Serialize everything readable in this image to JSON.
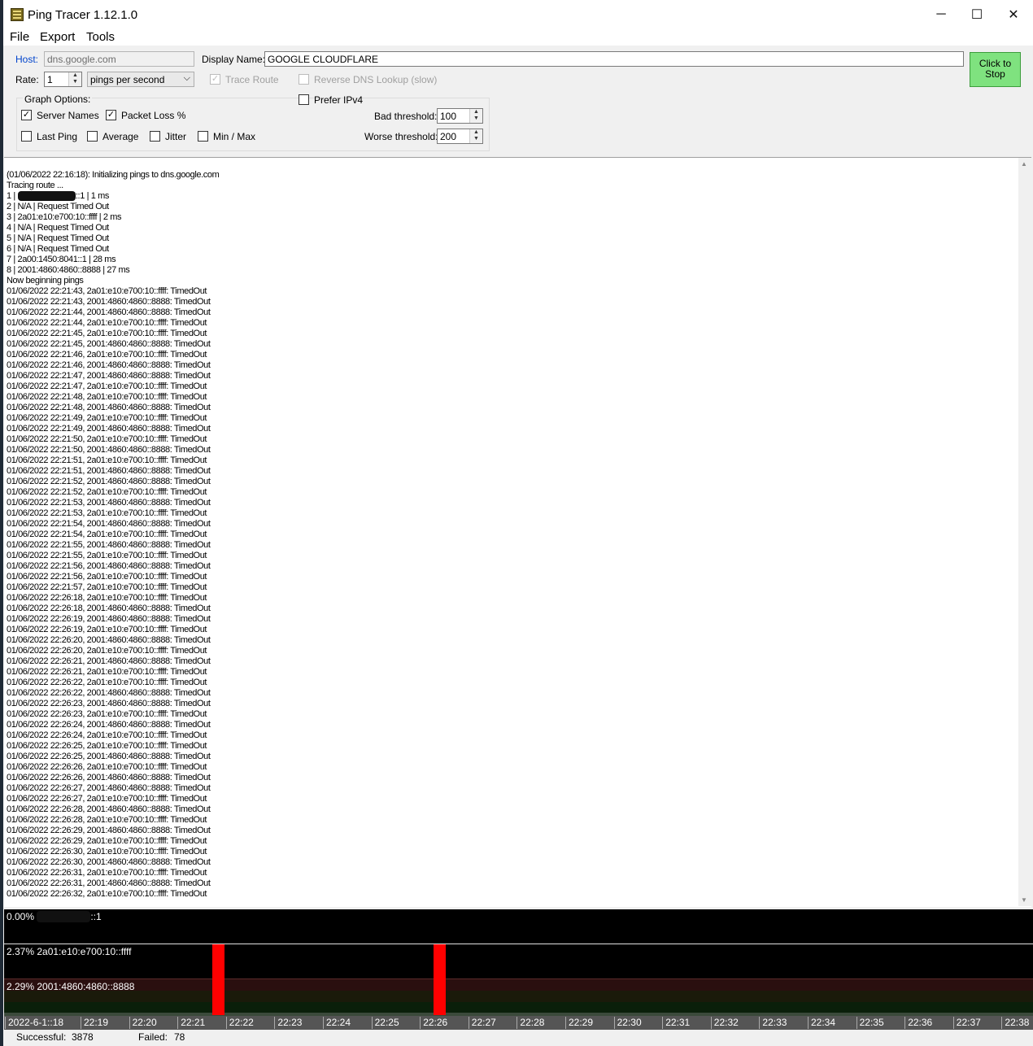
{
  "window": {
    "title": "Ping Tracer 1.12.1.0",
    "controls": [
      "─",
      "☐",
      "✕"
    ]
  },
  "menu": [
    "File",
    "Export",
    "Tools"
  ],
  "form": {
    "host_label": "Host:",
    "host_value": "dns.google.com",
    "display_name_label": "Display Name:",
    "display_name_value": "GOOGLE CLOUDFLARE",
    "rate_label": "Rate:",
    "rate_value": "1",
    "rate_unit": "pings per second",
    "trace_route": "Trace Route",
    "reverse_dns": "Reverse DNS Lookup (slow)",
    "prefer_ipv4": "Prefer IPv4",
    "graph_options": "Graph Options:",
    "server_names": "Server Names",
    "packet_loss": "Packet Loss %",
    "last_ping": "Last Ping",
    "average": "Average",
    "jitter": "Jitter",
    "min_max": "Min / Max",
    "bad_threshold_label": "Bad threshold:",
    "bad_threshold_value": "100",
    "worse_threshold_label": "Worse threshold:",
    "worse_threshold_value": "200",
    "stop_button": [
      "Click to",
      "Stop"
    ],
    "checks": {
      "trace_route": true,
      "reverse_dns": false,
      "prefer_ipv4": false,
      "server_names": true,
      "packet_loss": true,
      "last_ping": false,
      "average": false,
      "jitter": false,
      "min_max": false
    }
  },
  "log": {
    "lines": [
      "(01/06/2022 22:16:18): Initializing pings to dns.google.com",
      "Tracing route ...",
      "1 | [redacted]::1 | 1 ms",
      "2 | N/A | Request Timed Out",
      "3 | 2a01:e10:e700:10::ffff | 2 ms",
      "4 | N/A | Request Timed Out",
      "5 | N/A | Request Timed Out",
      "6 | N/A | Request Timed Out",
      "7 | 2a00:1450:8041::1 | 28 ms",
      "8 | 2001:4860:4860::8888 | 27 ms",
      "Now beginning pings",
      "01/06/2022 22:21:43, 2a01:e10:e700:10::ffff: TimedOut",
      "01/06/2022 22:21:43, 2001:4860:4860::8888: TimedOut",
      "01/06/2022 22:21:44, 2001:4860:4860::8888: TimedOut",
      "01/06/2022 22:21:44, 2a01:e10:e700:10::ffff: TimedOut",
      "01/06/2022 22:21:45, 2a01:e10:e700:10::ffff: TimedOut",
      "01/06/2022 22:21:45, 2001:4860:4860::8888: TimedOut",
      "01/06/2022 22:21:46, 2a01:e10:e700:10::ffff: TimedOut",
      "01/06/2022 22:21:46, 2001:4860:4860::8888: TimedOut",
      "01/06/2022 22:21:47, 2001:4860:4860::8888: TimedOut",
      "01/06/2022 22:21:47, 2a01:e10:e700:10::ffff: TimedOut",
      "01/06/2022 22:21:48, 2a01:e10:e700:10::ffff: TimedOut",
      "01/06/2022 22:21:48, 2001:4860:4860::8888: TimedOut",
      "01/06/2022 22:21:49, 2a01:e10:e700:10::ffff: TimedOut",
      "01/06/2022 22:21:49, 2001:4860:4860::8888: TimedOut",
      "01/06/2022 22:21:50, 2a01:e10:e700:10::ffff: TimedOut",
      "01/06/2022 22:21:50, 2001:4860:4860::8888: TimedOut",
      "01/06/2022 22:21:51, 2a01:e10:e700:10::ffff: TimedOut",
      "01/06/2022 22:21:51, 2001:4860:4860::8888: TimedOut",
      "01/06/2022 22:21:52, 2001:4860:4860::8888: TimedOut",
      "01/06/2022 22:21:52, 2a01:e10:e700:10::ffff: TimedOut",
      "01/06/2022 22:21:53, 2001:4860:4860::8888: TimedOut",
      "01/06/2022 22:21:53, 2a01:e10:e700:10::ffff: TimedOut",
      "01/06/2022 22:21:54, 2001:4860:4860::8888: TimedOut",
      "01/06/2022 22:21:54, 2a01:e10:e700:10::ffff: TimedOut",
      "01/06/2022 22:21:55, 2001:4860:4860::8888: TimedOut",
      "01/06/2022 22:21:55, 2a01:e10:e700:10::ffff: TimedOut",
      "01/06/2022 22:21:56, 2001:4860:4860::8888: TimedOut",
      "01/06/2022 22:21:56, 2a01:e10:e700:10::ffff: TimedOut",
      "01/06/2022 22:21:57, 2a01:e10:e700:10::ffff: TimedOut",
      "01/06/2022 22:26:18, 2a01:e10:e700:10::ffff: TimedOut",
      "01/06/2022 22:26:18, 2001:4860:4860::8888: TimedOut",
      "01/06/2022 22:26:19, 2001:4860:4860::8888: TimedOut",
      "01/06/2022 22:26:19, 2a01:e10:e700:10::ffff: TimedOut",
      "01/06/2022 22:26:20, 2001:4860:4860::8888: TimedOut",
      "01/06/2022 22:26:20, 2a01:e10:e700:10::ffff: TimedOut",
      "01/06/2022 22:26:21, 2001:4860:4860::8888: TimedOut",
      "01/06/2022 22:26:21, 2a01:e10:e700:10::ffff: TimedOut",
      "01/06/2022 22:26:22, 2a01:e10:e700:10::ffff: TimedOut",
      "01/06/2022 22:26:22, 2001:4860:4860::8888: TimedOut",
      "01/06/2022 22:26:23, 2001:4860:4860::8888: TimedOut",
      "01/06/2022 22:26:23, 2a01:e10:e700:10::ffff: TimedOut",
      "01/06/2022 22:26:24, 2001:4860:4860::8888: TimedOut",
      "01/06/2022 22:26:24, 2a01:e10:e700:10::ffff: TimedOut",
      "01/06/2022 22:26:25, 2a01:e10:e700:10::ffff: TimedOut",
      "01/06/2022 22:26:25, 2001:4860:4860::8888: TimedOut",
      "01/06/2022 22:26:26, 2a01:e10:e700:10::ffff: TimedOut",
      "01/06/2022 22:26:26, 2001:4860:4860::8888: TimedOut",
      "01/06/2022 22:26:27, 2001:4860:4860::8888: TimedOut",
      "01/06/2022 22:26:27, 2a01:e10:e700:10::ffff: TimedOut",
      "01/06/2022 22:26:28, 2001:4860:4860::8888: TimedOut",
      "01/06/2022 22:26:28, 2a01:e10:e700:10::ffff: TimedOut",
      "01/06/2022 22:26:29, 2001:4860:4860::8888: TimedOut",
      "01/06/2022 22:26:29, 2a01:e10:e700:10::ffff: TimedOut",
      "01/06/2022 22:26:30, 2a01:e10:e700:10::ffff: TimedOut",
      "01/06/2022 22:26:30, 2001:4860:4860::8888: TimedOut",
      "01/06/2022 22:26:31, 2a01:e10:e700:10::ffff: TimedOut",
      "01/06/2022 22:26:31, 2001:4860:4860::8888: TimedOut",
      "01/06/2022 22:26:32, 2a01:e10:e700:10::ffff: TimedOut"
    ]
  },
  "graphs": [
    {
      "label": "0.00% [redacted]::1",
      "loss": "0.00%"
    },
    {
      "label": "2.37% 2a01:e10:e700:10::ffff",
      "loss": "2.37%"
    },
    {
      "label": "2.29% 2001:4860:4860::8888",
      "loss": "2.29%"
    }
  ],
  "timeline": [
    "2022-6-1::18",
    "22:19",
    "22:20",
    "22:21",
    "22:22",
    "22:23",
    "22:24",
    "22:25",
    "22:26",
    "22:27",
    "22:28",
    "22:29",
    "22:30",
    "22:31",
    "22:32",
    "22:33",
    "22:34",
    "22:35",
    "22:36",
    "22:37",
    "22:38"
  ],
  "status": {
    "successful_label": "Successful:",
    "successful_value": "3878",
    "failed_label": "Failed:",
    "failed_value": "78"
  },
  "colors": {
    "stop_button": "#7fe27f",
    "timeout_marker": "#ff0000",
    "graph_background": "#000000"
  }
}
